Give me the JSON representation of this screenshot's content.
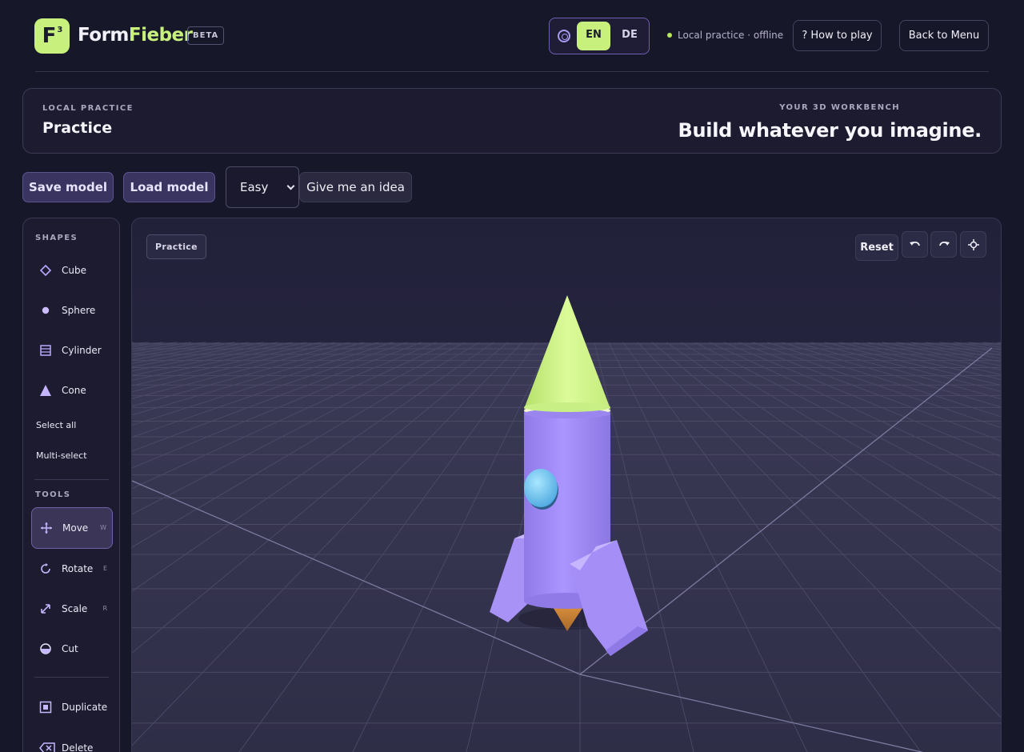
{
  "app": {
    "logo_glyph": "F",
    "logo_sup": "3",
    "brand_part1": "Form",
    "brand_part2": "Fieber",
    "beta_label": "BETA"
  },
  "topbar": {
    "lang_en": "EN",
    "lang_de": "DE",
    "status_text": "Local practice · offline",
    "how_to_play": "? How to play",
    "back_to_menu": "Back to Menu"
  },
  "header": {
    "eyebrow": "LOCAL PRACTICE",
    "title": "Practice",
    "eyebrow_right": "YOUR 3D WORKBENCH",
    "headline": "Build whatever you imagine."
  },
  "actions": {
    "save_label": "Save model",
    "load_label": "Load model",
    "difficulty_value": "Easy",
    "idea_label": "Give me an idea"
  },
  "sidebar": {
    "shapes_heading": "SHAPES",
    "shapes": [
      {
        "label": "Cube",
        "icon": "cube-icon"
      },
      {
        "label": "Sphere",
        "icon": "sphere-icon"
      },
      {
        "label": "Cylinder",
        "icon": "cylinder-icon"
      },
      {
        "label": "Cone",
        "icon": "cone-icon"
      }
    ],
    "select_all": "Select all",
    "multi_select": "Multi-select",
    "tools_heading": "TOOLS",
    "tools": [
      {
        "label": "Move",
        "key": "W",
        "icon": "move-icon",
        "active": true
      },
      {
        "label": "Rotate",
        "key": "E",
        "icon": "rotate-icon"
      },
      {
        "label": "Scale",
        "key": "R",
        "icon": "scale-icon"
      },
      {
        "label": "Cut",
        "key": "",
        "icon": "cut-icon"
      }
    ],
    "duplicate": "Duplicate",
    "delete": "Delete"
  },
  "viewport": {
    "badge": "Practice",
    "reset_label": "Reset",
    "icons": [
      "undo-icon",
      "redo-icon",
      "focus-icon"
    ]
  },
  "colors": {
    "accent": "#c8f07c",
    "purple": "#a58ef5",
    "background": "#17172a"
  }
}
